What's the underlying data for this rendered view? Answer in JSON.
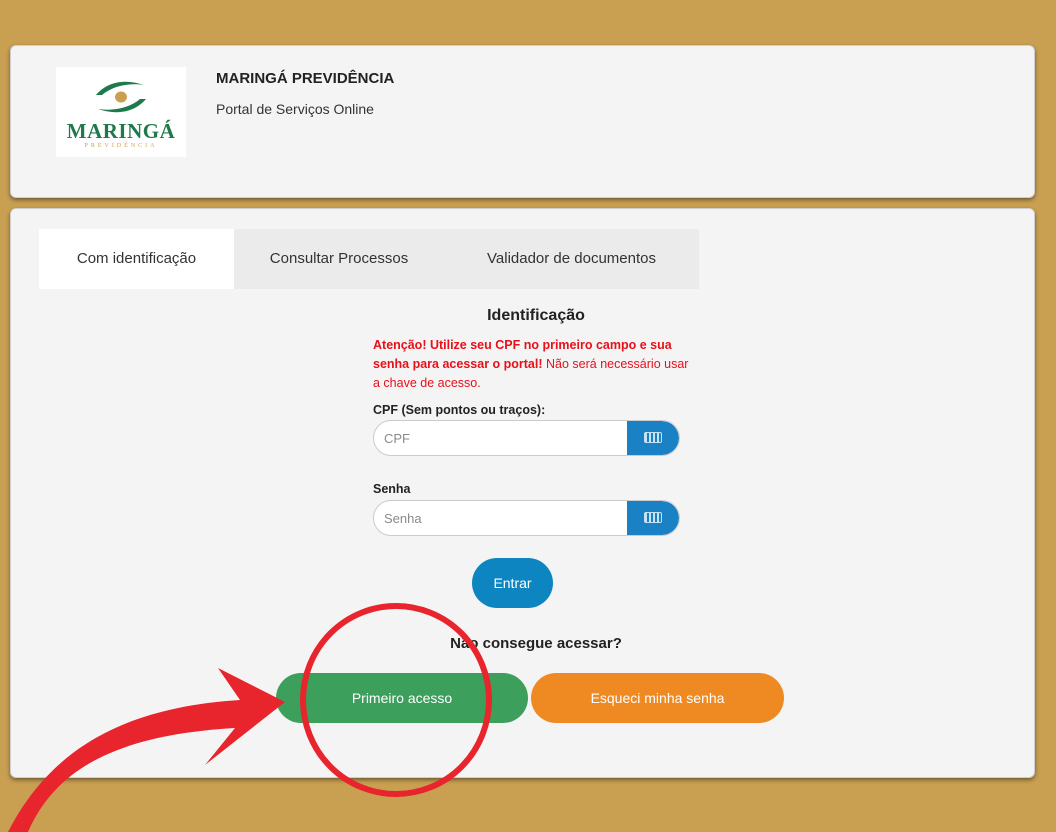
{
  "colors": {
    "background": "#c9a052",
    "accent_blue": "#0d85c0",
    "first_access_green": "#3c9f5c",
    "forgot_orange": "#ef8a22",
    "warning_red": "#e8101a",
    "annotation_red": "#e8242c"
  },
  "header": {
    "logo": {
      "name": "MARINGÁ",
      "sub": "PREVIDÊNCIA"
    },
    "org_name": "MARINGÁ PREVIDÊNCIA",
    "subtitle": "Portal de Serviços Online"
  },
  "tabs": [
    {
      "label": "Com identificação",
      "active": true
    },
    {
      "label": "Consultar Processos",
      "active": false
    },
    {
      "label": "Validador de documentos",
      "active": false
    }
  ],
  "form": {
    "title": "Identificação",
    "warning_bold": "Atenção! Utilize seu CPF no primeiro campo e sua senha para acessar o portal!",
    "warning_normal": " Não será necessário usar a chave de acesso.",
    "cpf": {
      "label": "CPF (Sem pontos ou traços):",
      "placeholder": "CPF",
      "value": "",
      "icon": "keyboard-icon"
    },
    "password": {
      "label": "Senha",
      "placeholder": "Senha",
      "value": "",
      "icon": "keyboard-icon"
    },
    "login_label": "Entrar",
    "help_text": "Não consegue acessar?",
    "first_access_label": "Primeiro acesso",
    "forgot_password_label": "Esqueci minha senha"
  }
}
